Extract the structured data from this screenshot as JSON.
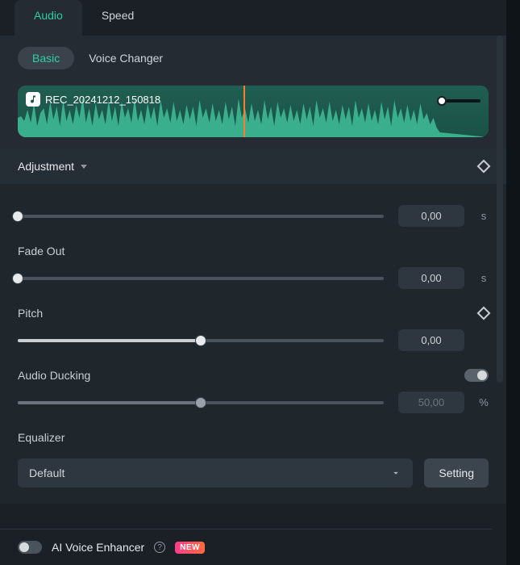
{
  "topTabs": {
    "audio": "Audio",
    "speed": "Speed",
    "active": "audio"
  },
  "subTabs": {
    "basic": "Basic",
    "voiceChanger": "Voice Changer",
    "active": "basic"
  },
  "clip": {
    "name": "REC_20241212_150818",
    "playheadPct": 48,
    "trimEndPct": 89
  },
  "adjustment": {
    "label": "Adjustment",
    "value": "0,00",
    "unit": "s",
    "sliderPct": 0
  },
  "fadeOut": {
    "label": "Fade Out",
    "value": "0,00",
    "unit": "s",
    "sliderPct": 0
  },
  "pitch": {
    "label": "Pitch",
    "value": "0,00",
    "sliderPct": 50
  },
  "ducking": {
    "label": "Audio Ducking",
    "enabled": false,
    "value": "50,00",
    "unit": "%",
    "sliderPct": 50
  },
  "equalizer": {
    "label": "Equalizer",
    "selected": "Default",
    "settingBtn": "Setting"
  },
  "aiEnhancer": {
    "label": "AI Voice Enhancer",
    "badge": "NEW",
    "enabled": false
  }
}
